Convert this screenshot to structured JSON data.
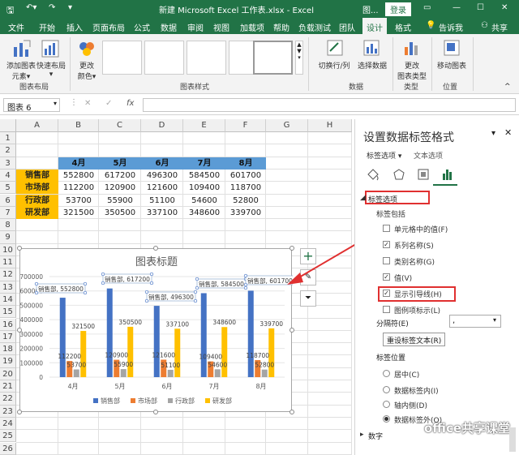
{
  "titlebar": {
    "file_title": "新建 Microsoft Excel 工作表.xlsx - Excel",
    "context": "图...",
    "login": "登录"
  },
  "tabs": [
    "文件",
    "开始",
    "插入",
    "页面布局",
    "公式",
    "数据",
    "审阅",
    "视图",
    "加载项",
    "帮助",
    "负载测试",
    "团队",
    "设计",
    "格式"
  ],
  "tabs_right": {
    "search": "告诉我",
    "share": "共享"
  },
  "ribbon": {
    "add_element": "添加图表\n元素▾",
    "quick_layout": "快速布局\n▾",
    "change_colors": "更改\n颜色▾",
    "switch_rowcol": "切换行/列",
    "select_data": "选择数据",
    "change_type": "更改\n图表类型",
    "move_chart": "移动图表",
    "groups": {
      "layout": "图表布局",
      "styles": "图表样式",
      "data": "数据",
      "type": "类型",
      "location": "位置"
    }
  },
  "formula": {
    "namebox": "图表 6",
    "fx": "fx",
    "cancel": "✕",
    "enter": "✓"
  },
  "grid": {
    "columns": [
      "A",
      "B",
      "C",
      "D",
      "E",
      "F",
      "G",
      "H"
    ],
    "rows": [
      "1",
      "2",
      "3",
      "4",
      "5",
      "6",
      "7",
      "8",
      "9",
      "10",
      "11",
      "12",
      "13",
      "14",
      "15",
      "16",
      "17",
      "18",
      "19",
      "20",
      "21",
      "22",
      "23",
      "24",
      "25",
      "26"
    ],
    "table_header": [
      "4月",
      "5月",
      "6月",
      "7月",
      "8月"
    ],
    "table_rows": [
      {
        "label": "销售部",
        "values": [
          "552800",
          "617200",
          "496300",
          "584500",
          "601700"
        ]
      },
      {
        "label": "市场部",
        "values": [
          "112200",
          "120900",
          "121600",
          "109400",
          "118700"
        ]
      },
      {
        "label": "行政部",
        "values": [
          "53700",
          "55900",
          "51100",
          "54600",
          "52800"
        ]
      },
      {
        "label": "研发部",
        "values": [
          "321500",
          "350500",
          "337100",
          "348600",
          "339700"
        ]
      }
    ]
  },
  "chart_data": {
    "type": "bar",
    "title": "图表标题",
    "categories": [
      "4月",
      "5月",
      "6月",
      "7月",
      "8月"
    ],
    "ylim": [
      0,
      700000
    ],
    "yticks": [
      "0",
      "100000",
      "200000",
      "300000",
      "400000",
      "500000",
      "600000",
      "700000"
    ],
    "series": [
      {
        "name": "销售部",
        "values": [
          552800,
          617200,
          496300,
          584500,
          601700
        ],
        "color": "#4472c4"
      },
      {
        "name": "市场部",
        "values": [
          112200,
          120900,
          121600,
          109400,
          118700
        ],
        "color": "#ed7d31"
      },
      {
        "name": "行政部",
        "values": [
          53700,
          55900,
          51100,
          54600,
          52800
        ],
        "color": "#a5a5a5"
      },
      {
        "name": "研发部",
        "values": [
          321500,
          350500,
          337100,
          348600,
          339700
        ],
        "color": "#ffc000"
      }
    ],
    "sales_labels": [
      "销售部, 552800",
      "销售部, 617200",
      "销售部, 496300",
      "销售部, 584500",
      "销售部, 601700"
    ],
    "legend_position": "bottom"
  },
  "pane": {
    "title": "设置数据标签格式",
    "tab1": "标签选项 ▾",
    "tab2": "文本选项",
    "section": "标签选项",
    "contains": "标签包括",
    "options": [
      {
        "label": "单元格中的值(F)",
        "checked": false
      },
      {
        "label": "系列名称(S)",
        "checked": true
      },
      {
        "label": "类别名称(G)",
        "checked": false
      },
      {
        "label": "值(V)",
        "checked": true
      },
      {
        "label": "显示引导线(H)",
        "checked": true
      },
      {
        "label": "图例项标示(L)",
        "checked": false
      }
    ],
    "separator_label": "分隔符(E)",
    "separator_value": ",",
    "reset": "重设标签文本(R)",
    "position_label": "标签位置",
    "positions": [
      {
        "label": "居中(C)",
        "selected": false
      },
      {
        "label": "数据标签内(I)",
        "selected": false
      },
      {
        "label": "轴内侧(D)",
        "selected": false
      },
      {
        "label": "数据标签外(O)",
        "selected": true
      }
    ],
    "number": "数字",
    "watermark": "office共享课堂"
  }
}
